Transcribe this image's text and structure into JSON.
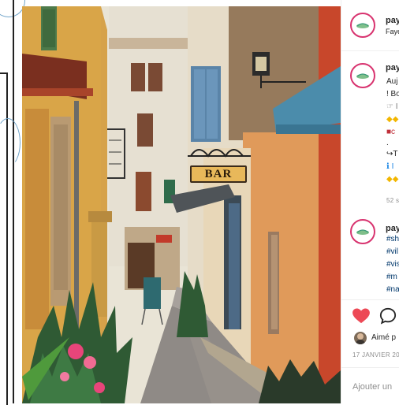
{
  "post": {
    "account_name": "pay",
    "account_sub": "Faye",
    "sign_text": "BAR"
  },
  "caption": {
    "account_name": "pay",
    "lines": [
      "Auj",
      "! Bo",
      "☞ I",
      "◆◆",
      "■c",
      ".",
      "↪T",
      "ℹ I",
      "◆◆"
    ],
    "time": "52 s"
  },
  "comment": {
    "account_name": "pay",
    "tags": [
      "#sh",
      "#vil",
      "#vis",
      "#m",
      "#na"
    ]
  },
  "actions": {
    "liked_by": "Aimé p",
    "date": "17 JANVIER 201",
    "add_comment_placeholder": "Ajouter un"
  },
  "colors": {
    "heart": "#ed4956",
    "avatar_ring": "#d8336f",
    "hashtag": "#00376b",
    "meta": "#8e8e8e"
  },
  "icons": {
    "like": "heart-icon",
    "comment": "comment-bubble-icon"
  }
}
